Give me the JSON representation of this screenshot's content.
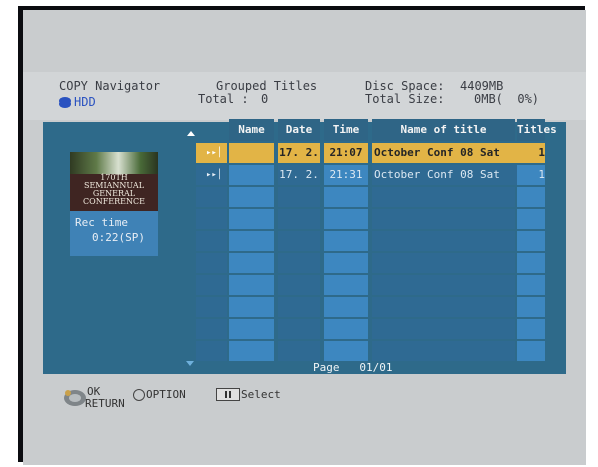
{
  "header": {
    "app_title": "COPY Navigator",
    "drive": "HDD",
    "view_title": "Grouped Titles",
    "total_label": "Total :",
    "total_value": "0",
    "disc_space_label": "Disc Space:",
    "disc_space_value": "4409MB",
    "total_size_label": "Total Size:",
    "total_size_value": "0MB(  0%)"
  },
  "left_panel": {
    "thumbnail_text": [
      "170TH",
      "SEMIANNUAL",
      "GENERAL",
      "CONFERENCE"
    ],
    "rec_time_label": "Rec time",
    "rec_time_value": "0:22(SP)"
  },
  "table": {
    "columns": [
      "Name",
      "Date",
      "Time",
      "Name of title",
      "Titles"
    ],
    "rows": [
      {
        "icon": "skip-forward-icon",
        "name": "",
        "date": "17. 2.",
        "time": "21:07",
        "title": "October Conf 08 Sat",
        "titles": "1",
        "selected": true
      },
      {
        "icon": "skip-forward-icon",
        "name": "",
        "date": "17. 2.",
        "time": "21:31",
        "title": "October Conf 08 Sat",
        "titles": "1",
        "selected": false
      }
    ],
    "empty_rows": 8
  },
  "pagination": {
    "label": "Page",
    "value": "01/01"
  },
  "footer": {
    "ok_label": "OK",
    "return_label": "RETURN",
    "option_label": "OPTION",
    "select_label": "Select"
  },
  "colors": {
    "selected_row": "#e2b446",
    "row_dark": "#2f6a93",
    "row_light": "#3d87c0"
  }
}
